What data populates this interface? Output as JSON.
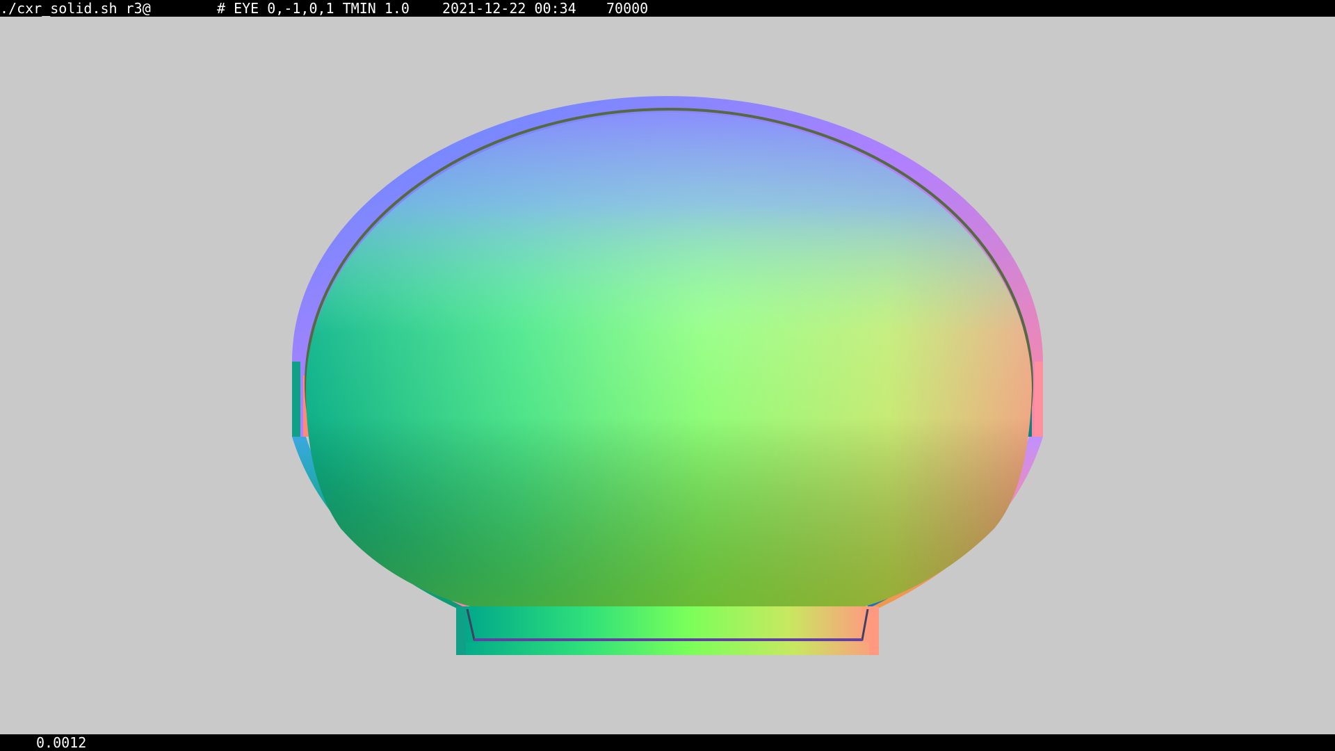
{
  "header": {
    "command": "./cxr_solid.sh r3@",
    "params": "# EYE 0,-1,0,1 TMIN 1.0",
    "datetime": "2021-12-22 00:34",
    "count": "70000"
  },
  "footer": {
    "value": "0.0012"
  },
  "colors": {
    "background": "#c9c9c9",
    "bars": "#000000",
    "bar_text": "#ffffff"
  }
}
